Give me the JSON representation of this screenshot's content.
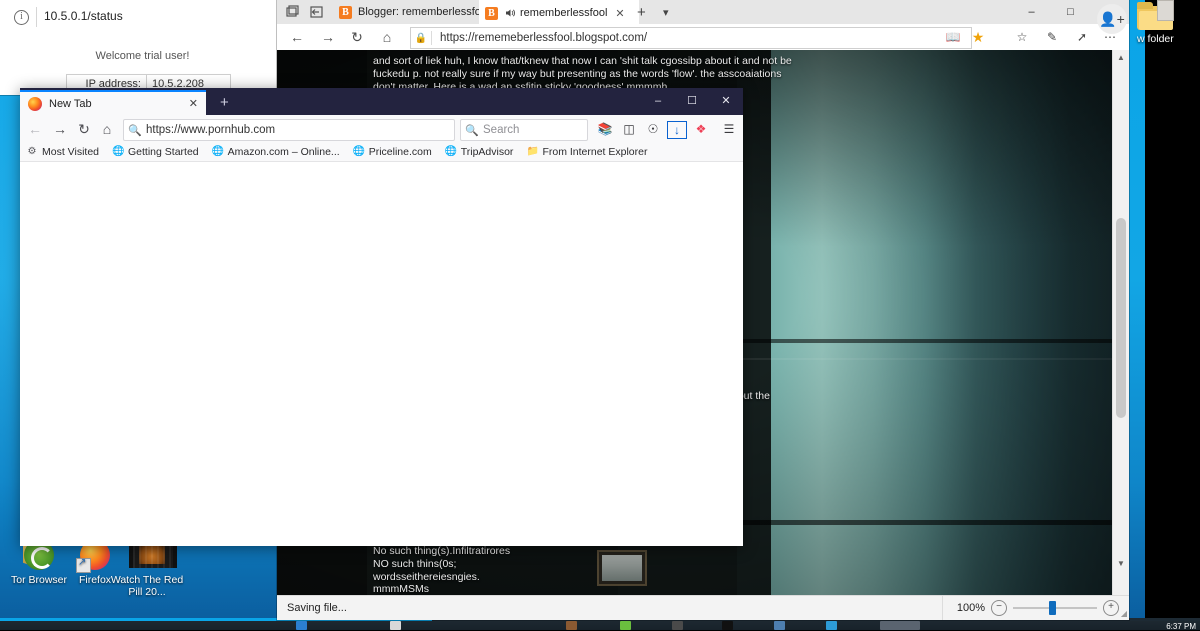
{
  "desktop": {
    "icons": [
      {
        "label": "Tor Browser",
        "icon": "tor-browser-icon"
      },
      {
        "label": "Firefox",
        "icon": "firefox-icon"
      },
      {
        "label": "Watch The Red Pill 20...",
        "icon": "video-file-icon"
      }
    ],
    "right_folder": {
      "label": "w folder",
      "icon": "folder-icon"
    },
    "wallpaper_color": "#0aa5e8"
  },
  "taskbar": {
    "clock": "6:37 PM"
  },
  "status_window": {
    "url": "10.5.0.1/status",
    "info_icon": "info-icon",
    "welcome": "Welcome trial user!",
    "table": {
      "label": "IP address:",
      "value": "10.5.2.208"
    }
  },
  "edge": {
    "system_icons": [
      "tab-preview-icon",
      "set-tabs-aside-icon"
    ],
    "tabs": [
      {
        "label": "Blogger: rememberlessfool",
        "favicon": "blogger-icon",
        "active": false,
        "audio": false
      },
      {
        "label": "rememberlessfool",
        "favicon": "blogger-icon",
        "active": true,
        "audio": true,
        "audio_icon": "speaker-icon",
        "close_icon": "close-icon"
      }
    ],
    "new_tab_icon": "plus-icon",
    "tab_menu_icon": "chevron-down-icon",
    "window_controls": [
      "minimize-icon",
      "maximize-icon",
      "close-icon"
    ],
    "nav": {
      "back_icon": "back-arrow-icon",
      "forward_icon": "forward-arrow-icon",
      "refresh_icon": "refresh-icon",
      "home_icon": "home-icon",
      "lock_icon": "lock-icon",
      "url": "https://rememeberlessfool.blogspot.com/"
    },
    "toolbar_icons": [
      "reading-view-icon",
      "favorite-star-icon",
      "reading-list-icon",
      "notes-icon",
      "share-icon",
      "more-icon"
    ],
    "add_profile_icon": "add-profile-icon",
    "scrollbar": {
      "up_icon": "scroll-up-icon",
      "down_icon": "scroll-down-icon"
    },
    "page": {
      "text_top": "and  sort of liek huh, I know that/tknew that now I can 'shit talk cgossibp about it and not be fuckedu p. not really sure if my way but presenting as the words 'flow'.  the asscoaiations don't matter. Here is a wad an ssfitin sticky 'goodness' mmmmh",
      "text_mid": "bout the",
      "text_bottom": "No  such thing(s).Infiltratirores\nNO such thins(0s;\nwordsseithereiesngies.\nmmmMSMs"
    },
    "statusbar": {
      "message": "Saving file...",
      "zoom_level": "100%",
      "zoom_out_icon": "zoom-out-icon",
      "zoom_in_icon": "zoom-in-icon",
      "resize_grip_icon": "resize-grip-icon"
    }
  },
  "firefox": {
    "tab": {
      "label": "New Tab",
      "favicon": "firefox-icon",
      "close_icon": "close-icon"
    },
    "new_tab_icon": "plus-icon",
    "window_controls": [
      "minimize-icon",
      "maximize-icon",
      "close-icon"
    ],
    "nav": {
      "back_icon": "back-arrow-icon",
      "forward_icon": "forward-arrow-icon",
      "reload_icon": "reload-icon",
      "home_icon": "home-icon"
    },
    "address": {
      "value": "https://www.pornhub.com",
      "search_icon": "search-icon"
    },
    "search": {
      "placeholder": "Search",
      "search_icon": "search-icon"
    },
    "toolbar_icons": [
      "library-icon",
      "sidebars-icon",
      "account-icon",
      "downloads-icon",
      "pocket-icon",
      "menu-icon"
    ],
    "bookmarks": [
      {
        "label": "Most Visited",
        "icon": "star-gear-icon"
      },
      {
        "label": "Getting Started",
        "icon": "globe-icon"
      },
      {
        "label": "Amazon.com – Online...",
        "icon": "globe-icon"
      },
      {
        "label": "Priceline.com",
        "icon": "globe-icon"
      },
      {
        "label": "TripAdvisor",
        "icon": "globe-icon"
      },
      {
        "label": "From Internet Explorer",
        "icon": "folder-icon"
      }
    ]
  }
}
